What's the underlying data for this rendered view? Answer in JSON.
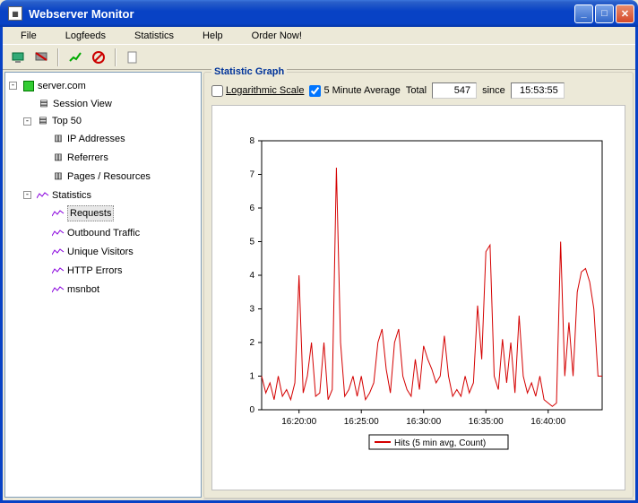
{
  "window": {
    "title": "Webserver Monitor"
  },
  "menu": {
    "file": "File",
    "logfeeds": "Logfeeds",
    "statistics": "Statistics",
    "help": "Help",
    "order": "Order Now!"
  },
  "tree": {
    "root": "server.com",
    "session_view": "Session View",
    "top50": "Top 50",
    "ip": "IP Addresses",
    "referrers": "Referrers",
    "pages": "Pages / Resources",
    "stats": "Statistics",
    "requests": "Requests",
    "outbound": "Outbound Traffic",
    "unique": "Unique Visitors",
    "errors": "HTTP Errors",
    "msnbot": "msnbot"
  },
  "panel": {
    "title": "Statistic Graph",
    "log_scale": "Logarithmic Scale",
    "five_min": "5 Minute Average",
    "total_label": "Total",
    "total_value": "547",
    "since_label": "since",
    "since_value": "15:53:55",
    "legend": "Hits (5 min avg, Count)"
  },
  "chart_data": {
    "type": "line",
    "title": "",
    "xlabel": "",
    "ylabel": "",
    "ylim": [
      0,
      8
    ],
    "yticks": [
      0,
      1,
      2,
      3,
      4,
      5,
      6,
      7,
      8
    ],
    "xticks": [
      "16:20:00",
      "16:25:00",
      "16:30:00",
      "16:35:00",
      "16:40:00"
    ],
    "series": [
      {
        "name": "Hits (5 min avg, Count)",
        "color": "#d40000",
        "x_seconds_from_start": [
          0,
          20,
          40,
          60,
          80,
          100,
          120,
          140,
          160,
          180,
          200,
          220,
          240,
          260,
          280,
          300,
          320,
          340,
          360,
          380,
          400,
          420,
          440,
          460,
          480,
          500,
          520,
          540,
          560,
          580,
          600,
          620,
          640,
          660,
          680,
          700,
          720,
          740,
          760,
          780,
          800,
          820,
          840,
          860,
          880,
          900,
          920,
          940,
          960,
          980,
          1000,
          1020,
          1040,
          1060,
          1080,
          1100,
          1120,
          1140,
          1160,
          1180,
          1200,
          1220,
          1240,
          1260,
          1280,
          1300,
          1320,
          1340,
          1360,
          1380,
          1400,
          1420,
          1440,
          1460,
          1480,
          1500,
          1520,
          1540,
          1560,
          1580,
          1600,
          1620,
          1640
        ],
        "values": [
          1.0,
          0.5,
          0.8,
          0.3,
          1.0,
          0.4,
          0.6,
          0.3,
          0.8,
          4.0,
          0.5,
          1.0,
          2.0,
          0.4,
          0.5,
          2.0,
          0.3,
          0.6,
          7.2,
          2.0,
          0.4,
          0.6,
          1.0,
          0.4,
          1.0,
          0.3,
          0.5,
          0.8,
          2.0,
          2.4,
          1.2,
          0.5,
          2.0,
          2.4,
          1.0,
          0.6,
          0.4,
          1.5,
          0.6,
          1.9,
          1.5,
          1.2,
          0.8,
          1.0,
          2.2,
          1.0,
          0.4,
          0.6,
          0.4,
          1.0,
          0.5,
          0.8,
          3.1,
          1.5,
          4.7,
          4.9,
          1.0,
          0.6,
          2.1,
          0.8,
          2.0,
          0.5,
          2.8,
          1.0,
          0.5,
          0.8,
          0.4,
          1.0,
          0.3,
          0.2,
          0.1,
          0.2,
          5.0,
          1.0,
          2.6,
          1.0,
          3.5,
          4.1,
          4.2,
          3.8,
          3.0,
          1.0,
          1.0
        ]
      }
    ]
  }
}
